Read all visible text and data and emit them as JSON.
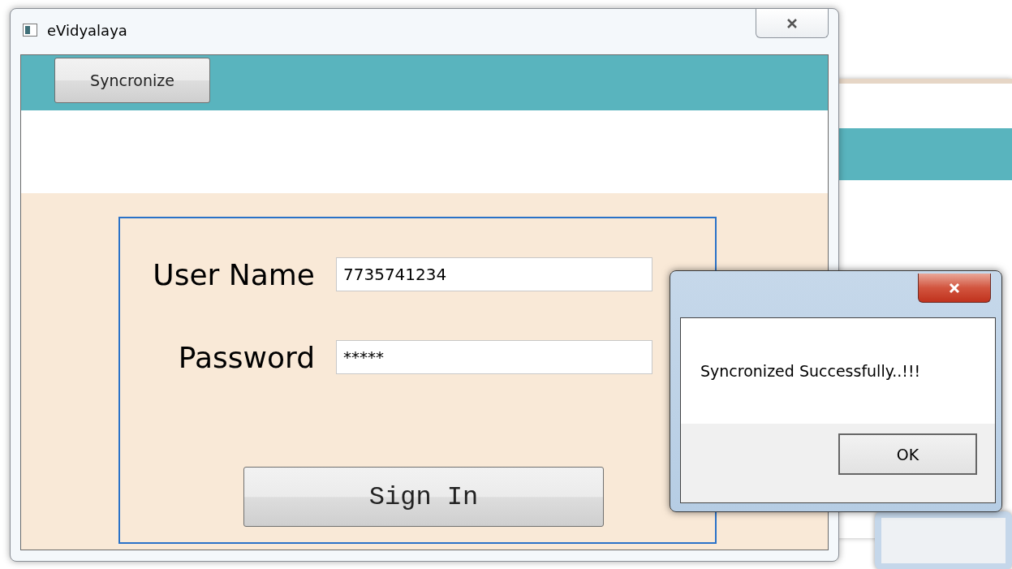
{
  "window": {
    "title": "eVidyalaya"
  },
  "toolbar": {
    "buttons": [
      "Syncronize"
    ]
  },
  "login": {
    "fields": [
      {
        "label": "User Name",
        "value": "7735741234"
      },
      {
        "label": "Password",
        "value": "*****"
      }
    ],
    "submit": "Sign In"
  },
  "dialog": {
    "message": "Syncronized Successfully..!!!",
    "buttons": [
      "OK"
    ]
  }
}
